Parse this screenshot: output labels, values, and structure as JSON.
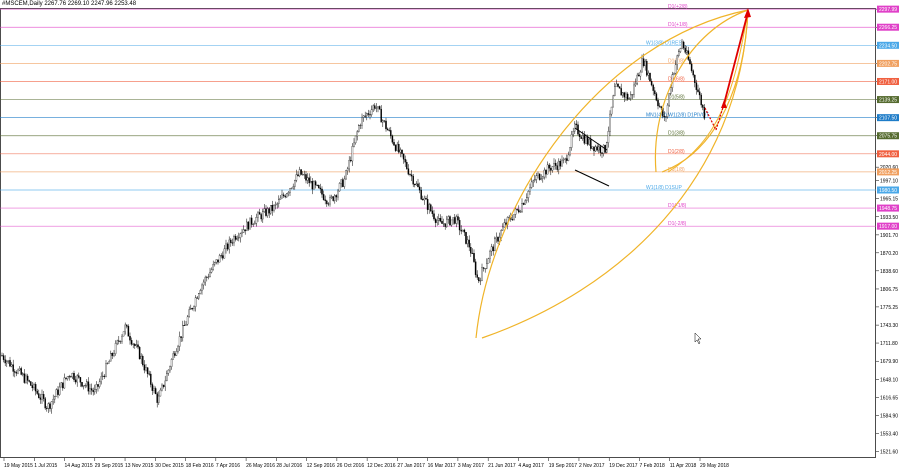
{
  "header": {
    "title": "#MSCEM,Daily  2267.76 2269.10 2247.96 2253.48"
  },
  "chart_data": {
    "type": "candlestick",
    "symbol": "#MSCEM",
    "timeframe": "Daily",
    "ohlc_readout": {
      "open": 2267.76,
      "high": 2269.1,
      "low": 2247.96,
      "close": 2253.48
    },
    "ylim": [
      1510,
      2300
    ],
    "y_ticks": [
      2297.99,
      2266.25,
      2234.5,
      2202.75,
      2171.0,
      2139.25,
      2107.5,
      2075.75,
      2044.0,
      2020.6,
      1997.1,
      1965.15,
      1933.5,
      1901.7,
      1870.2,
      1838.6,
      1806.75,
      1775.25,
      1743.3,
      1711.8,
      1679.9,
      1648.1,
      1616.65,
      1584.9,
      1553.4,
      1521.6
    ],
    "x_tick_labels": [
      "19 May 2015",
      "1 Jul 2015",
      "14 Aug 2015",
      "29 Sep 2015",
      "13 Nov 2015",
      "30 Dec 2015",
      "18 Feb 2016",
      "7 Apr 2016",
      "26 May 2016",
      "28 Jul 2016",
      "12 Sep 2016",
      "26 Oct 2016",
      "12 Dec 2016",
      "27 Jan 2017",
      "16 Mar 2017",
      "3 May 2017",
      "21 Jun 2017",
      "4 Aug 2017",
      "19 Sep 2017",
      "2 Nov 2017",
      "19 Dec 2017",
      "7 Feb 2018",
      "11 Apr 2018",
      "29 May 2018"
    ],
    "level_lines": [
      {
        "label": "D1(+2/8)",
        "value": 2297.99,
        "color": "#e040c8"
      },
      {
        "label": "D1(+1/8)",
        "value": 2266.25,
        "color": "#e040c8"
      },
      {
        "label": "W1(3/8) D1RES",
        "value": 2234.5,
        "color": "#4aa8e8"
      },
      {
        "label": "D1(7/8)",
        "value": 2202.75,
        "color": "#f0a060"
      },
      {
        "label": "D1(6/8)",
        "value": 2171.0,
        "color": "#f06040"
      },
      {
        "label": "D1(5/8)",
        "value": 2139.25,
        "color": "#556b2f"
      },
      {
        "label": "MN1(4/8) W1(2/8) D1PIVOT",
        "value": 2107.5,
        "color": "#1e7cc8"
      },
      {
        "label": "D1(3/8)",
        "value": 2075.75,
        "color": "#556b2f"
      },
      {
        "label": "D1(2/8)",
        "value": 2044.0,
        "color": "#f06040"
      },
      {
        "label": "D1(1/8)",
        "value": 2012.25,
        "color": "#f0a060"
      },
      {
        "label": "W1(1/8) D1SUP",
        "value": 1980.5,
        "color": "#4aa8e8"
      },
      {
        "label": "D1(-1/8)",
        "value": 1948.75,
        "color": "#e040c8"
      },
      {
        "label": "D1(-2/8)",
        "value": 1917.0,
        "color": "#e040c8"
      }
    ],
    "price_tags": [
      2297.99,
      2266.25,
      2234.5,
      2202.75,
      2171.0,
      2139.25,
      2107.5,
      2075.75,
      2044.0,
      2012.25,
      1980.5,
      1948.75,
      1917.0
    ],
    "current_price": 2253.48,
    "colors": {
      "candles": "#000000",
      "arcs": "#f0b429",
      "arrows": "#e00000",
      "axis": "#000000"
    }
  }
}
